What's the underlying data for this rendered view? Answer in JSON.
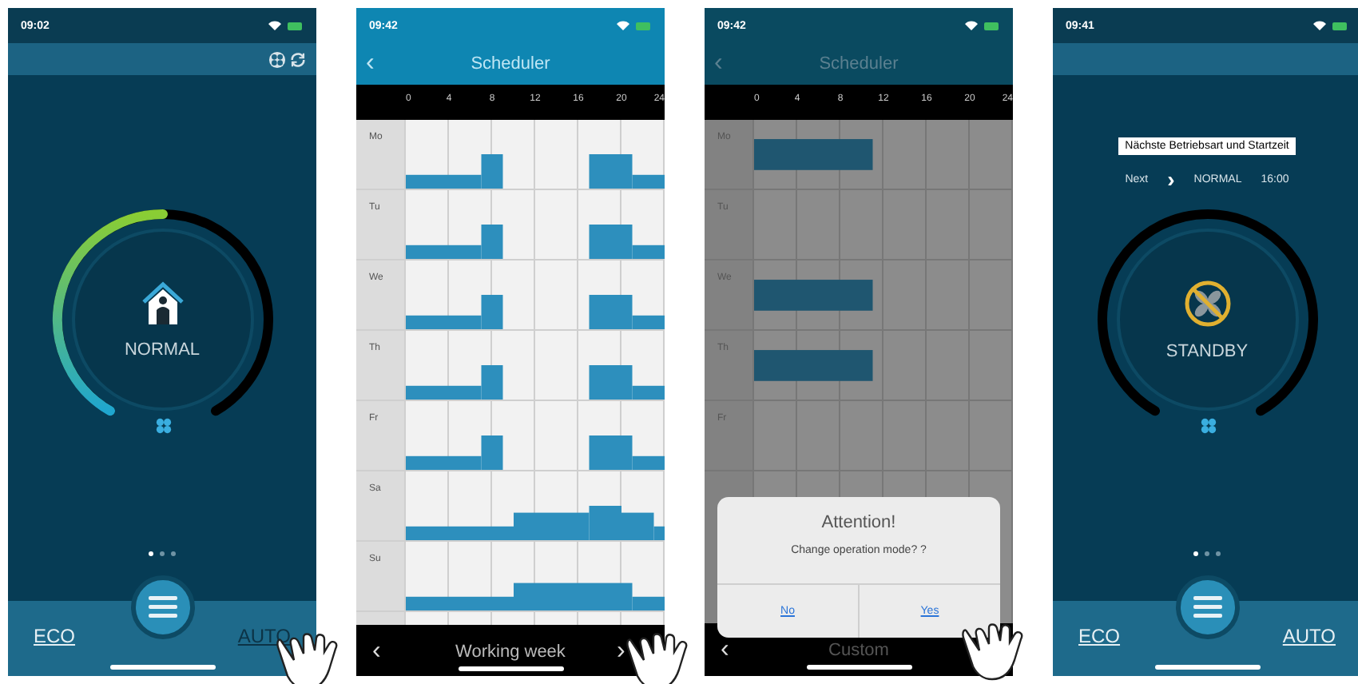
{
  "phones": [
    {
      "kind": "home",
      "status": {
        "time": "09:02"
      },
      "toolbar_buttons": [
        {
          "kind": "fan"
        },
        {
          "kind": "refresh"
        }
      ],
      "gauge": {
        "kind": "normal",
        "label": "NORMAL"
      },
      "page_dots": [
        {
          "selected": true
        },
        {
          "selected": false
        },
        {
          "selected": false
        }
      ],
      "modes": [
        {
          "label": "ECO",
          "pressed": false
        },
        {
          "label": "AUTO",
          "pressed": true
        }
      ],
      "tap_hint": true
    },
    {
      "kind": "scheduler",
      "dimmed": false,
      "status": {
        "time": "09:42"
      },
      "back": "‹",
      "title": "Scheduler",
      "hours": [
        "0",
        "4",
        "8",
        "12",
        "16",
        "20",
        "24"
      ],
      "days": [
        {
          "label": "Mo",
          "slots": [
            {
              "kind": "low"
            },
            {
              "kind": "low"
            },
            {
              "kind": "low"
            },
            {
              "kind": "low"
            },
            {
              "kind": "low"
            },
            {
              "kind": "low"
            },
            {
              "kind": "low"
            },
            {
              "kind": "high"
            },
            {
              "kind": "high"
            },
            {
              "kind": "off"
            },
            {
              "kind": "off"
            },
            {
              "kind": "off"
            },
            {
              "kind": "off"
            },
            {
              "kind": "off"
            },
            {
              "kind": "off"
            },
            {
              "kind": "off"
            },
            {
              "kind": "off"
            },
            {
              "kind": "high"
            },
            {
              "kind": "high"
            },
            {
              "kind": "high"
            },
            {
              "kind": "high"
            },
            {
              "kind": "low"
            },
            {
              "kind": "low"
            },
            {
              "kind": "low"
            }
          ]
        },
        {
          "label": "Tu",
          "slots": [
            {
              "kind": "low"
            },
            {
              "kind": "low"
            },
            {
              "kind": "low"
            },
            {
              "kind": "low"
            },
            {
              "kind": "low"
            },
            {
              "kind": "low"
            },
            {
              "kind": "low"
            },
            {
              "kind": "high"
            },
            {
              "kind": "high"
            },
            {
              "kind": "off"
            },
            {
              "kind": "off"
            },
            {
              "kind": "off"
            },
            {
              "kind": "off"
            },
            {
              "kind": "off"
            },
            {
              "kind": "off"
            },
            {
              "kind": "off"
            },
            {
              "kind": "off"
            },
            {
              "kind": "high"
            },
            {
              "kind": "high"
            },
            {
              "kind": "high"
            },
            {
              "kind": "high"
            },
            {
              "kind": "low"
            },
            {
              "kind": "low"
            },
            {
              "kind": "low"
            }
          ]
        },
        {
          "label": "We",
          "slots": [
            {
              "kind": "low"
            },
            {
              "kind": "low"
            },
            {
              "kind": "low"
            },
            {
              "kind": "low"
            },
            {
              "kind": "low"
            },
            {
              "kind": "low"
            },
            {
              "kind": "low"
            },
            {
              "kind": "high"
            },
            {
              "kind": "high"
            },
            {
              "kind": "off"
            },
            {
              "kind": "off"
            },
            {
              "kind": "off"
            },
            {
              "kind": "off"
            },
            {
              "kind": "off"
            },
            {
              "kind": "off"
            },
            {
              "kind": "off"
            },
            {
              "kind": "off"
            },
            {
              "kind": "high"
            },
            {
              "kind": "high"
            },
            {
              "kind": "high"
            },
            {
              "kind": "high"
            },
            {
              "kind": "low"
            },
            {
              "kind": "low"
            },
            {
              "kind": "low"
            }
          ]
        },
        {
          "label": "Th",
          "slots": [
            {
              "kind": "low"
            },
            {
              "kind": "low"
            },
            {
              "kind": "low"
            },
            {
              "kind": "low"
            },
            {
              "kind": "low"
            },
            {
              "kind": "low"
            },
            {
              "kind": "low"
            },
            {
              "kind": "high"
            },
            {
              "kind": "high"
            },
            {
              "kind": "off"
            },
            {
              "kind": "off"
            },
            {
              "kind": "off"
            },
            {
              "kind": "off"
            },
            {
              "kind": "off"
            },
            {
              "kind": "off"
            },
            {
              "kind": "off"
            },
            {
              "kind": "off"
            },
            {
              "kind": "high"
            },
            {
              "kind": "high"
            },
            {
              "kind": "high"
            },
            {
              "kind": "high"
            },
            {
              "kind": "low"
            },
            {
              "kind": "low"
            },
            {
              "kind": "low"
            }
          ]
        },
        {
          "label": "Fr",
          "slots": [
            {
              "kind": "low"
            },
            {
              "kind": "low"
            },
            {
              "kind": "low"
            },
            {
              "kind": "low"
            },
            {
              "kind": "low"
            },
            {
              "kind": "low"
            },
            {
              "kind": "low"
            },
            {
              "kind": "high"
            },
            {
              "kind": "high"
            },
            {
              "kind": "off"
            },
            {
              "kind": "off"
            },
            {
              "kind": "off"
            },
            {
              "kind": "off"
            },
            {
              "kind": "off"
            },
            {
              "kind": "off"
            },
            {
              "kind": "off"
            },
            {
              "kind": "off"
            },
            {
              "kind": "high"
            },
            {
              "kind": "high"
            },
            {
              "kind": "high"
            },
            {
              "kind": "high"
            },
            {
              "kind": "low"
            },
            {
              "kind": "low"
            },
            {
              "kind": "low"
            }
          ]
        },
        {
          "label": "Sa",
          "slots": [
            {
              "kind": "low"
            },
            {
              "kind": "low"
            },
            {
              "kind": "low"
            },
            {
              "kind": "low"
            },
            {
              "kind": "low"
            },
            {
              "kind": "low"
            },
            {
              "kind": "low"
            },
            {
              "kind": "low"
            },
            {
              "kind": "low"
            },
            {
              "kind": "low"
            },
            {
              "kind": "mid"
            },
            {
              "kind": "mid"
            },
            {
              "kind": "mid"
            },
            {
              "kind": "mid"
            },
            {
              "kind": "mid"
            },
            {
              "kind": "mid"
            },
            {
              "kind": "mid"
            },
            {
              "kind": "high"
            },
            {
              "kind": "high"
            },
            {
              "kind": "high"
            },
            {
              "kind": "mid"
            },
            {
              "kind": "mid"
            },
            {
              "kind": "mid"
            },
            {
              "kind": "low"
            }
          ]
        },
        {
          "label": "Su",
          "slots": [
            {
              "kind": "low"
            },
            {
              "kind": "low"
            },
            {
              "kind": "low"
            },
            {
              "kind": "low"
            },
            {
              "kind": "low"
            },
            {
              "kind": "low"
            },
            {
              "kind": "low"
            },
            {
              "kind": "low"
            },
            {
              "kind": "low"
            },
            {
              "kind": "low"
            },
            {
              "kind": "mid"
            },
            {
              "kind": "mid"
            },
            {
              "kind": "mid"
            },
            {
              "kind": "mid"
            },
            {
              "kind": "mid"
            },
            {
              "kind": "mid"
            },
            {
              "kind": "mid"
            },
            {
              "kind": "mid"
            },
            {
              "kind": "mid"
            },
            {
              "kind": "mid"
            },
            {
              "kind": "mid"
            },
            {
              "kind": "low"
            },
            {
              "kind": "low"
            },
            {
              "kind": "low"
            }
          ]
        }
      ],
      "footer": {
        "prev": "‹",
        "label": "Working week",
        "next": "›"
      },
      "tap_hint": true
    },
    {
      "kind": "scheduler",
      "dimmed": true,
      "status": {
        "time": "09:42"
      },
      "back": "‹",
      "title": "Scheduler",
      "hours": [
        "0",
        "4",
        "8",
        "12",
        "16",
        "20",
        "24"
      ],
      "days": [
        {
          "label": "Mo",
          "slots": [
            {
              "kind": "block"
            },
            {
              "kind": "block"
            },
            {
              "kind": "block"
            },
            {
              "kind": "block"
            },
            {
              "kind": "block"
            },
            {
              "kind": "block"
            },
            {
              "kind": "block"
            },
            {
              "kind": "block"
            },
            {
              "kind": "block"
            },
            {
              "kind": "block"
            },
            {
              "kind": "block"
            },
            {
              "kind": "off"
            },
            {
              "kind": "off"
            },
            {
              "kind": "off"
            },
            {
              "kind": "off"
            },
            {
              "kind": "off"
            },
            {
              "kind": "off"
            },
            {
              "kind": "off"
            },
            {
              "kind": "off"
            },
            {
              "kind": "off"
            },
            {
              "kind": "off"
            },
            {
              "kind": "off"
            },
            {
              "kind": "off"
            },
            {
              "kind": "off"
            }
          ]
        },
        {
          "label": "Tu"
        },
        {
          "label": "We",
          "slots": [
            {
              "kind": "block"
            },
            {
              "kind": "block"
            },
            {
              "kind": "block"
            },
            {
              "kind": "block"
            },
            {
              "kind": "block"
            },
            {
              "kind": "block"
            },
            {
              "kind": "block"
            },
            {
              "kind": "block"
            },
            {
              "kind": "block"
            },
            {
              "kind": "block"
            },
            {
              "kind": "block"
            },
            {
              "kind": "off"
            },
            {
              "kind": "off"
            },
            {
              "kind": "off"
            },
            {
              "kind": "off"
            },
            {
              "kind": "off"
            },
            {
              "kind": "off"
            },
            {
              "kind": "off"
            },
            {
              "kind": "off"
            },
            {
              "kind": "off"
            },
            {
              "kind": "off"
            },
            {
              "kind": "off"
            },
            {
              "kind": "off"
            },
            {
              "kind": "off"
            }
          ]
        },
        {
          "label": "Th",
          "slots": [
            {
              "kind": "block"
            },
            {
              "kind": "block"
            },
            {
              "kind": "block"
            },
            {
              "kind": "block"
            },
            {
              "kind": "block"
            },
            {
              "kind": "block"
            },
            {
              "kind": "block"
            },
            {
              "kind": "block"
            },
            {
              "kind": "block"
            },
            {
              "kind": "block"
            },
            {
              "kind": "block"
            },
            {
              "kind": "off"
            },
            {
              "kind": "off"
            },
            {
              "kind": "off"
            },
            {
              "kind": "off"
            },
            {
              "kind": "off"
            },
            {
              "kind": "off"
            },
            {
              "kind": "off"
            },
            {
              "kind": "off"
            },
            {
              "kind": "off"
            },
            {
              "kind": "off"
            },
            {
              "kind": "off"
            },
            {
              "kind": "off"
            },
            {
              "kind": "off"
            }
          ]
        },
        {
          "label": "Fr"
        }
      ],
      "footer": {
        "prev": "‹",
        "label": "Custom"
      },
      "dialog": {
        "title": "Attention!",
        "message": "Change operation mode? ?",
        "buttons": [
          "No",
          "Yes"
        ]
      },
      "tap_hint": true
    },
    {
      "kind": "home",
      "status": {
        "time": "09:41"
      },
      "annotation": "Nächste Betriebsart und Startzeit",
      "next": {
        "label": "Next",
        "arrow": "›",
        "mode": "NORMAL",
        "time": "16:00"
      },
      "gauge": {
        "kind": "standby",
        "label": "STANDBY"
      },
      "page_dots": [
        {
          "selected": true
        },
        {
          "selected": false
        },
        {
          "selected": false
        }
      ],
      "modes": [
        {
          "label": "ECO",
          "pressed": false
        },
        {
          "label": "AUTO",
          "pressed": false
        }
      ]
    }
  ]
}
